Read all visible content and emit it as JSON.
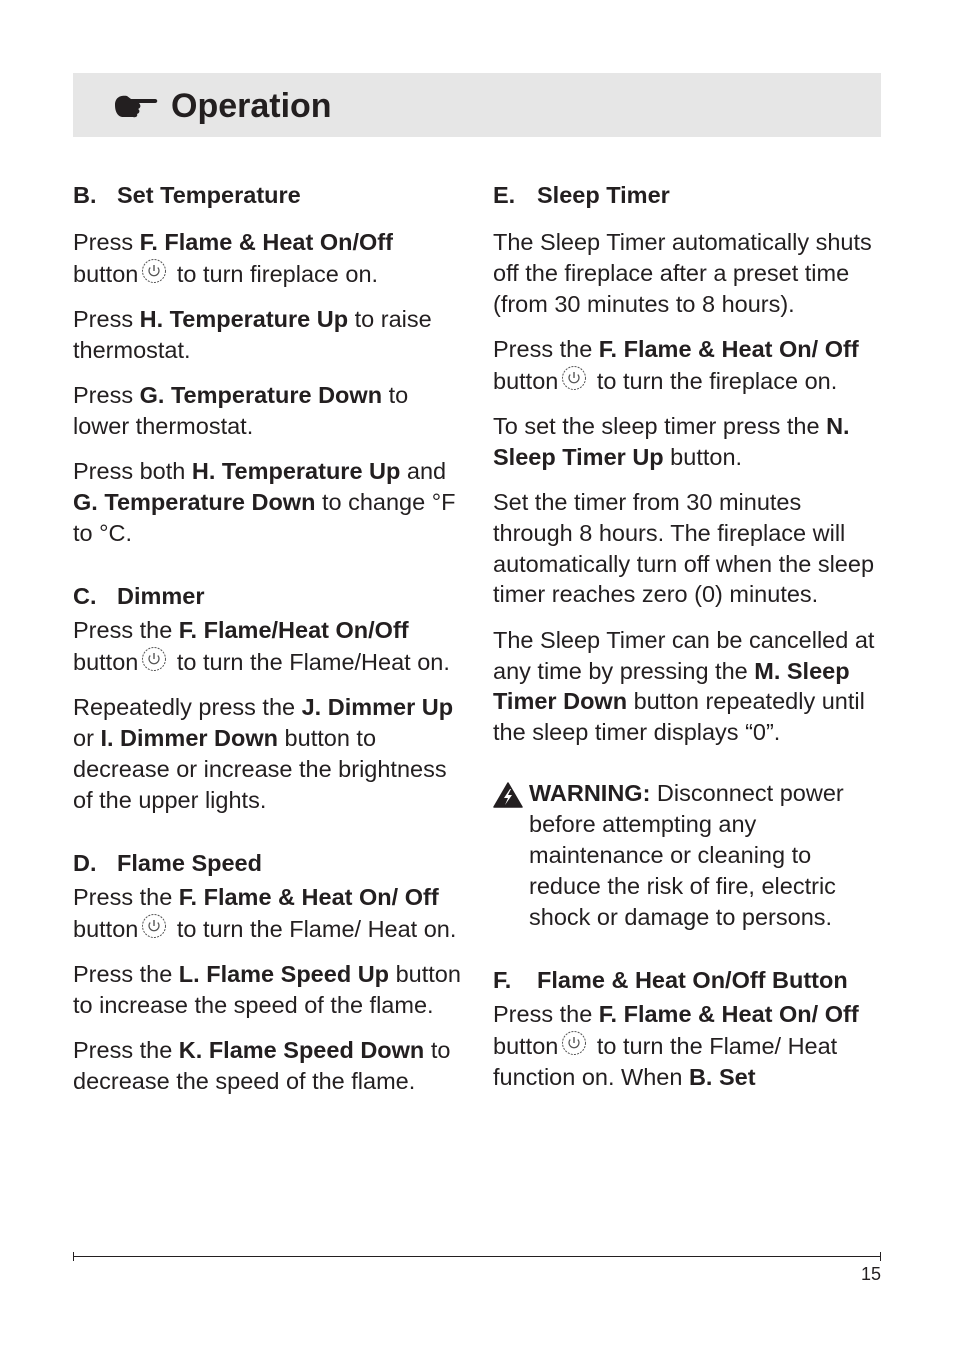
{
  "header": {
    "icon": "pointing-hand-icon",
    "title": "Operation"
  },
  "left_column": {
    "set_temperature": {
      "letter": "B.",
      "title": "Set Temperature",
      "p1": {
        "pre": "Press ",
        "bold": "F.  Flame & Heat On/Off",
        "mid": " button",
        "post": " to turn fireplace on."
      },
      "p2": {
        "pre": "Press ",
        "bold": "H. Temperature Up",
        "post": " to raise thermostat."
      },
      "p3": {
        "pre": "Press ",
        "bold": "G. Temperature Down",
        "post": " to lower thermostat."
      },
      "p4": {
        "pre": "Press both ",
        "bold1": "H. Temperature Up",
        "mid": " and ",
        "bold2": "G. Temperature Down",
        "post": " to change °F to °C."
      }
    },
    "dimmer": {
      "letter": "C.",
      "title": "Dimmer",
      "p1": {
        "pre": "Press the ",
        "bold": "F. Flame/Heat On/Off",
        "mid": " button",
        "post": " to turn the Flame/Heat on."
      },
      "p2": {
        "pre": "Repeatedly press the ",
        "bold1": "J. Dimmer Up",
        "mid": " or ",
        "bold2": "I. Dimmer Down",
        "post": " button to decrease or increase the brightness of the upper lights."
      }
    },
    "flame_speed": {
      "letter": "D.",
      "title": "Flame Speed",
      "p1": {
        "pre": "Press the ",
        "bold": "F. Flame & Heat On/ Off",
        "mid": " button",
        "post": " to turn the Flame/ Heat on."
      },
      "p2": {
        "pre": "Press the ",
        "bold": "L. Flame Speed Up",
        "post": " button to increase the speed of the flame."
      },
      "p3": {
        "pre": "Press the ",
        "bold": "K. Flame Speed Down",
        "post": " to decrease the speed of the flame."
      }
    }
  },
  "right_column": {
    "sleep_timer": {
      "letter": "E.",
      "title": "Sleep Timer",
      "p1": "The Sleep Timer automatically shuts off the fireplace after a preset time (from 30 minutes to 8 hours).",
      "p2": {
        "pre": "Press the ",
        "bold": "F. Flame & Heat On/ Off",
        "mid": " button",
        "post": " to turn the fireplace on."
      },
      "p3": {
        "pre": "To set the sleep timer press the ",
        "bold": "N. Sleep Timer Up",
        "post": " button."
      },
      "p4": "Set the timer from 30 minutes through 8 hours.  The fireplace will automatically turn off when the sleep timer reaches zero (0) minutes.",
      "p5": {
        "pre": "The Sleep Timer can be cancelled at any time by pressing the ",
        "bold": "M. Sleep Timer Down",
        "post": " button repeatedly until the sleep timer displays “0”."
      }
    },
    "warning": {
      "icon": "warning-shock-icon",
      "label": "WARNING:",
      "text": "  Disconnect power before attempting any maintenance or cleaning to reduce the risk of fire, electric shock or damage to persons."
    },
    "flame_heat_button": {
      "letter": "F.",
      "title": "Flame & Heat On/Off Button",
      "p1": {
        "pre": "Press the ",
        "bold": "F. Flame & Heat On/ Off",
        "mid": " button",
        "post": " to turn the Flame/ Heat function on.  When ",
        "bold2": "B. Set"
      }
    }
  },
  "footer": {
    "page_number": "15"
  }
}
